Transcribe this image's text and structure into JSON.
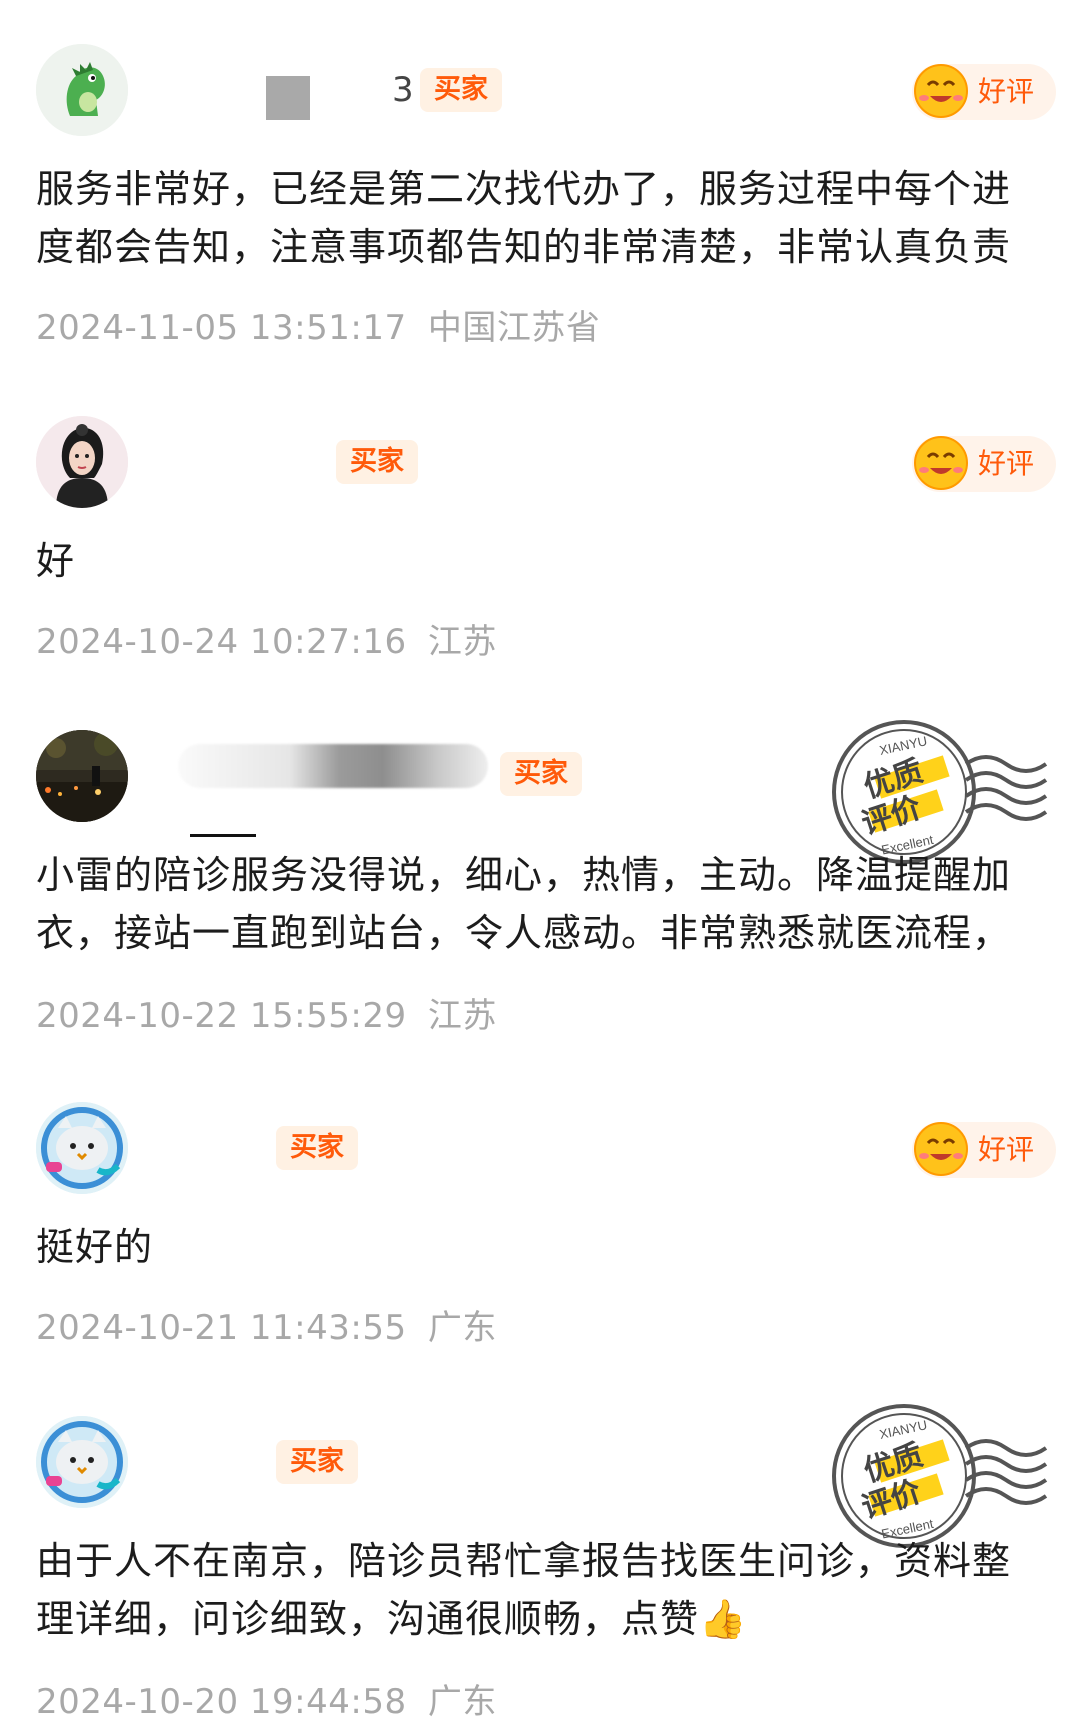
{
  "buyer_tag": "买家",
  "good_rating": "好评",
  "stamp": {
    "top": "XIANYU",
    "main1": "优质",
    "main2": "评价",
    "bottom": "Excellent"
  },
  "reviews": [
    {
      "content": "服务非常好，已经是第二次找代办了，服务过程中每个进度都会告知，注意事项都告知的非常清楚，非常认真负责",
      "timestamp": "2024-11-05 13:51:17",
      "location": "中国江苏省",
      "avatar_icon": "green-dinosaur-icon",
      "badge": "好评",
      "name_partial": "3"
    },
    {
      "content": "好",
      "timestamp": "2024-10-24 10:27:16",
      "location": "江苏",
      "avatar_icon": "woman-portrait-icon",
      "badge": "好评"
    },
    {
      "content": "小雷的陪诊服务没得说，细心，热情，主动。降温提醒加衣，接站一直跑到站台，令人感动。非常熟悉就医流程，",
      "timestamp": "2024-10-22 15:55:29",
      "location": "江苏",
      "avatar_icon": "night-scene-photo-icon",
      "badge": "优质评价"
    },
    {
      "content": "挺好的",
      "timestamp": "2024-10-21 11:43:55",
      "location": "广东",
      "avatar_icon": "cat-astronaut-icon",
      "badge": "好评"
    },
    {
      "content": "由于人不在南京，陪诊员帮忙拿报告找医生问诊，资料整理详细，问诊细致，沟通很顺畅，点赞👍",
      "timestamp": "2024-10-20 19:44:58",
      "location": "广东",
      "avatar_icon": "cat-astronaut-icon",
      "badge": "优质评价"
    }
  ],
  "colors": {
    "accent": "#ff5a0a",
    "tag_bg": "#fff1e3",
    "meta_text": "#a8a8a8"
  }
}
